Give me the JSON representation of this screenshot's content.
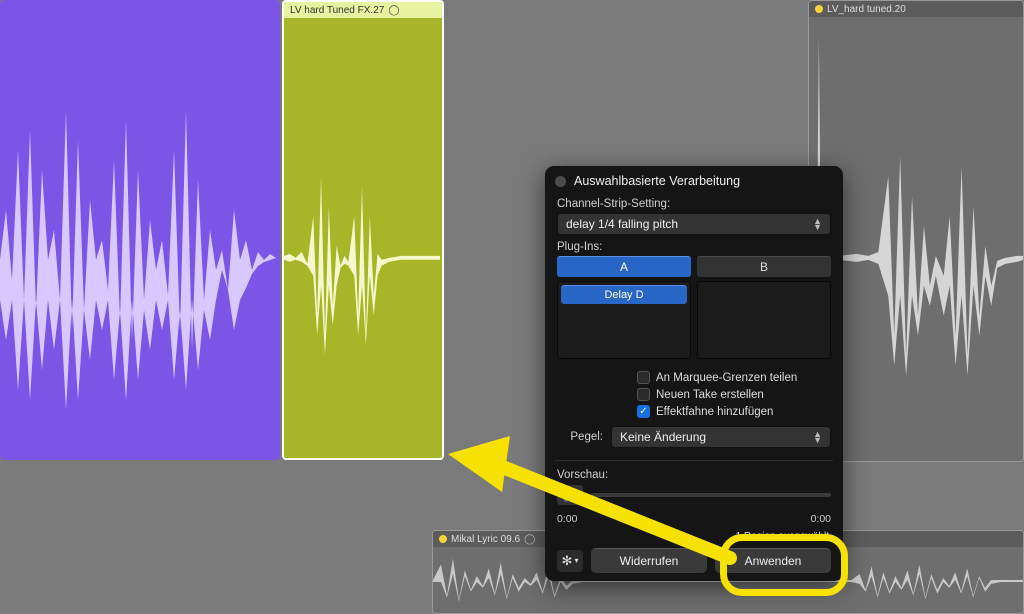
{
  "regions": {
    "purple": {
      "label": ""
    },
    "olive": {
      "label": "LV hard Tuned FX.27",
      "loop_glyph": "⃝"
    },
    "gray": {
      "label": "LV_hard tuned.20"
    },
    "small": {
      "label": "Mikal Lyric 09.6",
      "loop_glyph": "⃝"
    }
  },
  "panel": {
    "title": "Auswahlbasierte Verarbeitung",
    "channelStrip": {
      "label": "Channel-Strip-Setting:",
      "value": "delay 1/4 falling pitch"
    },
    "plugins": {
      "label": "Plug-Ins:",
      "tabA": "A",
      "tabB": "B",
      "chipA": "Delay D"
    },
    "checks": {
      "marquee": "An Marquee-Grenzen teilen",
      "newTake": "Neuen Take erstellen",
      "fxFlag": "Effektfahne hinzufügen"
    },
    "pegel": {
      "label": "Pegel:",
      "value": "Keine Änderung"
    },
    "preview": {
      "label": "Vorschau:",
      "t0": "0:00",
      "t1": "0:00"
    },
    "status": "1 Region ausgewählt",
    "buttons": {
      "undo": "Widerrufen",
      "apply": "Anwenden"
    }
  }
}
